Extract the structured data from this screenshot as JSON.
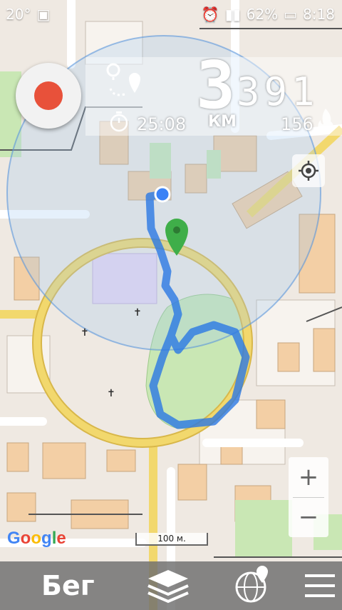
{
  "status_bar": {
    "temperature": "20°",
    "battery": "62%",
    "time": "8:18"
  },
  "stats": {
    "distance_main": "3",
    "distance_frac": "391",
    "unit": "КМ",
    "duration": "25:08",
    "calories": "156"
  },
  "map": {
    "attribution": "Google",
    "scale_label": "100 м."
  },
  "zoom": {
    "in_label": "+",
    "out_label": "−"
  },
  "bottom_bar": {
    "activity": "Бег"
  },
  "colors": {
    "record": "#e8513a",
    "track": "#3b82f6",
    "pin": "#3fae49"
  }
}
